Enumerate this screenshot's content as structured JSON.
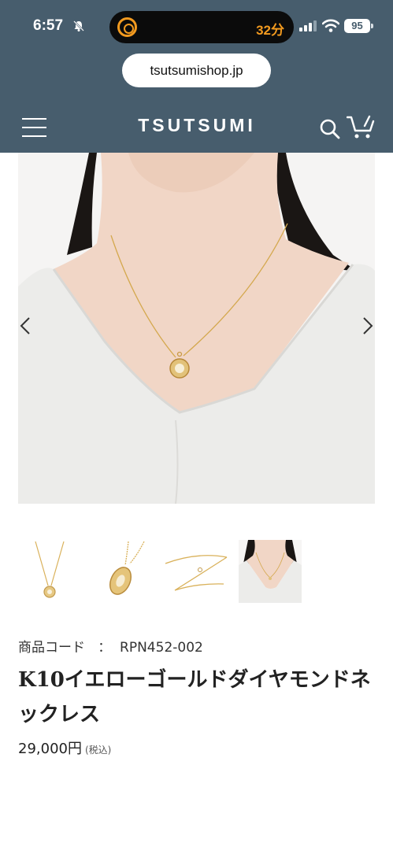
{
  "status_bar": {
    "time": "6:57",
    "island_text": "32分",
    "battery": "95"
  },
  "browser": {
    "url": "tsutsumishop.jp"
  },
  "header": {
    "logo": "TSUTSUMI"
  },
  "gallery": {
    "thumbnails": [
      "pendant-front",
      "pendant-side",
      "chain",
      "model-wearing"
    ]
  },
  "product": {
    "code_label": "商品コード",
    "code_separator": "：",
    "code_value": "RPN452-002",
    "name": "K10イエローゴールドダイヤモンドネックレス",
    "price": "29,000円",
    "tax_note": "(税込)"
  },
  "colors": {
    "header_bg": "#475d6d",
    "accent_orange": "#f29a1f",
    "gold": "#d9b15a"
  }
}
